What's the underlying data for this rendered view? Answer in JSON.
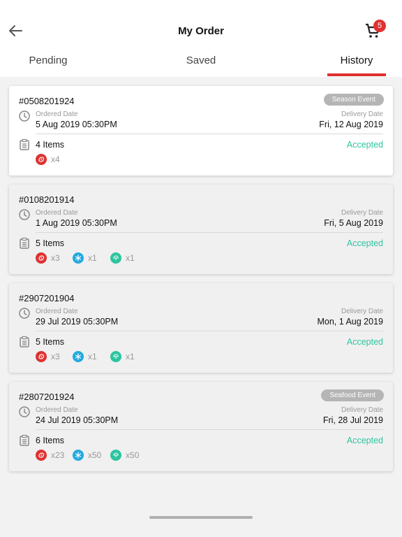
{
  "header": {
    "title": "My Order",
    "cart_count": "5"
  },
  "tabs": [
    {
      "label": "Pending"
    },
    {
      "label": "Saved"
    },
    {
      "label": "History"
    }
  ],
  "active_tab": "History",
  "colors": {
    "accent": "#e03131",
    "status_accepted": "#2ec4a0",
    "meat": "#e03131",
    "frozen": "#22a9e0",
    "vegetable": "#2ec4a0"
  },
  "orders": [
    {
      "number": "#0508201924",
      "event": "Season Event",
      "ordered_label": "Ordered Date",
      "ordered_date": "5 Aug 2019 05:30PM",
      "delivery_label": "Delivery Date",
      "delivery_date": "Fri, 12 Aug 2019",
      "items": "4 Items",
      "status": "Accepted",
      "cats": [
        {
          "icon": "meat-icon",
          "qty": "x4"
        }
      ]
    },
    {
      "number": "#0108201914",
      "event": "",
      "ordered_label": "Ordered Date",
      "ordered_date": "1 Aug 2019 05:30PM",
      "delivery_label": "Delivery Date",
      "delivery_date": "Fri, 5 Aug 2019",
      "items": "5 Items",
      "status": "Accepted",
      "cats": [
        {
          "icon": "meat-icon",
          "qty": "x3"
        },
        {
          "icon": "frozen-icon",
          "qty": "x1"
        },
        {
          "icon": "vegetable-icon",
          "qty": "x1"
        }
      ]
    },
    {
      "number": "#2907201904",
      "event": "",
      "ordered_label": "Ordered Date",
      "ordered_date": "29 Jul 2019 05:30PM",
      "delivery_label": "Delivery Date",
      "delivery_date": "Mon, 1 Aug 2019",
      "items": "5 Items",
      "status": "Accepted",
      "cats": [
        {
          "icon": "meat-icon",
          "qty": "x3"
        },
        {
          "icon": "frozen-icon",
          "qty": "x1"
        },
        {
          "icon": "vegetable-icon",
          "qty": "x1"
        }
      ]
    },
    {
      "number": "#2807201924",
      "event": "Seafood Event",
      "ordered_label": "Ordered Date",
      "ordered_date": "24 Jul 2019 05:30PM",
      "delivery_label": "Delivery Date",
      "delivery_date": "Fri, 28 Jul 2019",
      "items": "6 Items",
      "status": "Accepted",
      "cats": [
        {
          "icon": "meat-icon",
          "qty": "x23"
        },
        {
          "icon": "frozen-icon",
          "qty": "x50"
        },
        {
          "icon": "vegetable-icon",
          "qty": "x50"
        }
      ]
    }
  ]
}
